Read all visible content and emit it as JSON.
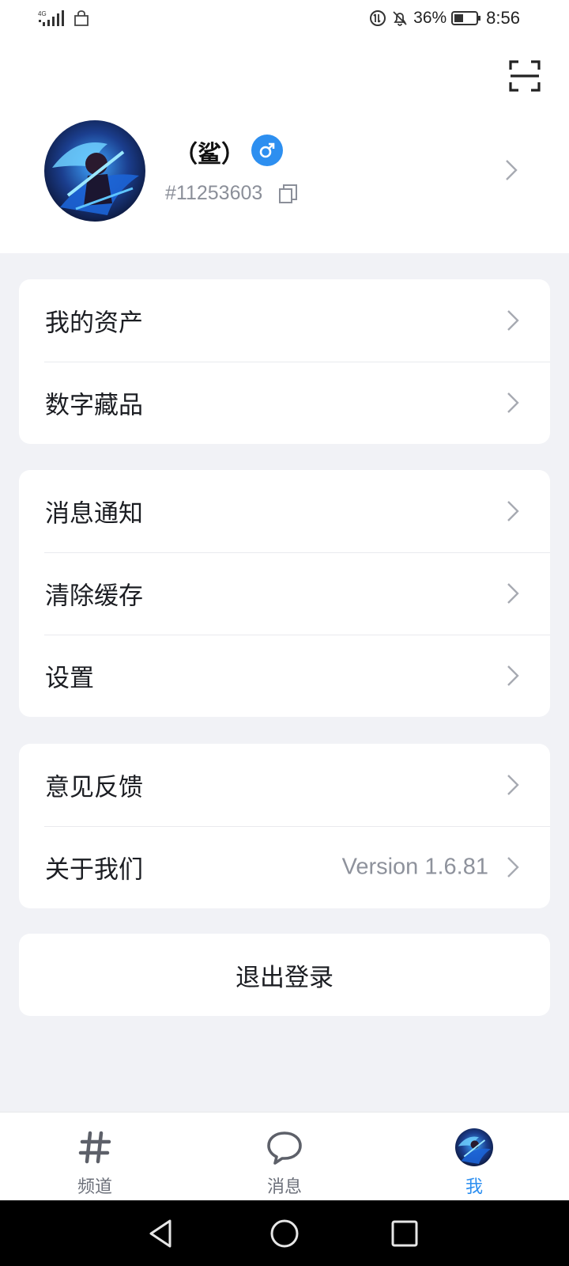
{
  "status_bar": {
    "network": "4G",
    "battery_percent": "36%",
    "time": "8:56"
  },
  "header": {
    "scan_icon": "scan-icon"
  },
  "profile": {
    "nickname": "（鲨）",
    "gender_icon": "male-icon",
    "gender_color": "#2d8ff0",
    "user_id": "#11253603"
  },
  "menu": {
    "group1": [
      {
        "label": "我的资产"
      },
      {
        "label": "数字藏品"
      }
    ],
    "group2": [
      {
        "label": "消息通知"
      },
      {
        "label": "清除缓存"
      },
      {
        "label": "设置"
      }
    ],
    "group3": [
      {
        "label": "意见反馈"
      },
      {
        "label": "关于我们",
        "value": "Version 1.6.81"
      }
    ],
    "logout_label": "退出登录"
  },
  "tabs": [
    {
      "label": "频道",
      "icon": "hash-icon"
    },
    {
      "label": "消息",
      "icon": "chat-bubble-icon"
    },
    {
      "label": "我",
      "icon": "avatar"
    }
  ],
  "colors": {
    "accent": "#2d8ff0",
    "page_background": "#f1f2f6"
  }
}
